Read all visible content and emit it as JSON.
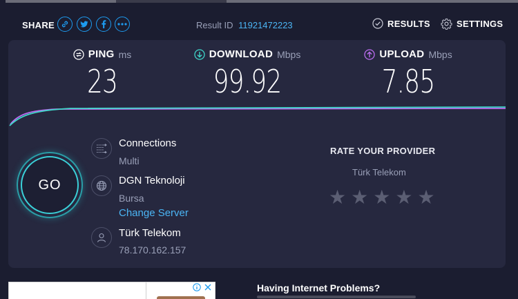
{
  "header": {
    "share_label": "SHARE",
    "share_icons": [
      "link-icon",
      "twitter-icon",
      "facebook-icon",
      "more-icon"
    ],
    "result_label": "Result ID",
    "result_id": "11921472223",
    "results_label": "RESULTS",
    "settings_label": "SETTINGS"
  },
  "metrics": {
    "ping": {
      "name": "PING",
      "unit": "ms",
      "value": "23",
      "icon": "ping-icon",
      "color": "#ffffff"
    },
    "download": {
      "name": "DOWNLOAD",
      "unit": "Mbps",
      "value": "99.92",
      "icon": "download-arrow-icon",
      "color": "#3fd6c9"
    },
    "upload": {
      "name": "UPLOAD",
      "unit": "Mbps",
      "value": "7.85",
      "icon": "upload-arrow-icon",
      "color": "#bb6df0"
    }
  },
  "go_label": "GO",
  "connection": {
    "title": "Connections",
    "mode": "Multi"
  },
  "server": {
    "name": "DGN Teknoloji",
    "location": "Bursa",
    "change_label": "Change Server"
  },
  "client": {
    "isp": "Türk Telekom",
    "ip": "78.170.162.157"
  },
  "rate": {
    "title": "RATE YOUR PROVIDER",
    "isp": "Türk Telekom",
    "stars_total": 5,
    "stars_selected": 0
  },
  "bottom": {
    "problems_title": "Having Internet Problems?"
  },
  "colors": {
    "background": "#1b1d30",
    "card": "#26283f",
    "accent_blue": "#4bb5f5",
    "download": "#3fd6c9",
    "upload": "#bb6df0",
    "muted": "#9aa0b8"
  }
}
